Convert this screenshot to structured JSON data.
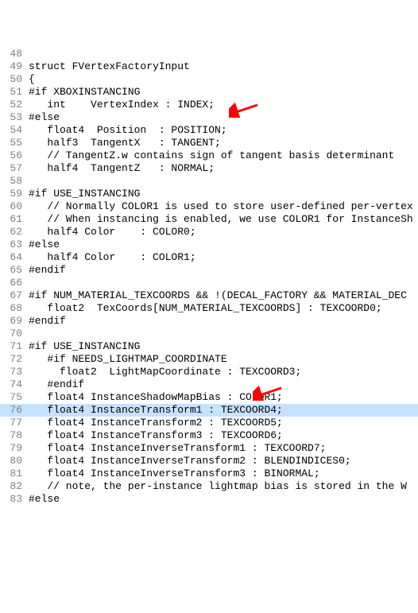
{
  "lines": [
    {
      "num": "48",
      "text": "",
      "hl": false
    },
    {
      "num": "49",
      "text": "struct FVertexFactoryInput",
      "hl": false
    },
    {
      "num": "50",
      "text": "{",
      "hl": false
    },
    {
      "num": "51",
      "text": "#if XBOXINSTANCING",
      "hl": false
    },
    {
      "num": "52",
      "text": "   int    VertexIndex : INDEX;",
      "hl": false
    },
    {
      "num": "53",
      "text": "#else",
      "hl": false
    },
    {
      "num": "54",
      "text": "   float4  Position  : POSITION;",
      "hl": false
    },
    {
      "num": "55",
      "text": "   half3  TangentX   : TANGENT;",
      "hl": false
    },
    {
      "num": "56",
      "text": "   // TangentZ.w contains sign of tangent basis determinant",
      "hl": false
    },
    {
      "num": "57",
      "text": "   half4  TangentZ   : NORMAL;",
      "hl": false
    },
    {
      "num": "58",
      "text": "",
      "hl": false
    },
    {
      "num": "59",
      "text": "#if USE_INSTANCING",
      "hl": false
    },
    {
      "num": "60",
      "text": "   // Normally COLOR1 is used to store user-defined per-vertex",
      "hl": false
    },
    {
      "num": "61",
      "text": "   // When instancing is enabled, we use COLOR1 for InstanceSh",
      "hl": false
    },
    {
      "num": "62",
      "text": "   half4 Color    : COLOR0;",
      "hl": false
    },
    {
      "num": "63",
      "text": "#else",
      "hl": false
    },
    {
      "num": "64",
      "text": "   half4 Color    : COLOR1;",
      "hl": false
    },
    {
      "num": "65",
      "text": "#endif",
      "hl": false
    },
    {
      "num": "66",
      "text": "",
      "hl": false
    },
    {
      "num": "67",
      "text": "#if NUM_MATERIAL_TEXCOORDS && !(DECAL_FACTORY && MATERIAL_DEC",
      "hl": false
    },
    {
      "num": "68",
      "text": "   float2  TexCoords[NUM_MATERIAL_TEXCOORDS] : TEXCOORD0;",
      "hl": false
    },
    {
      "num": "69",
      "text": "#endif",
      "hl": false
    },
    {
      "num": "70",
      "text": "",
      "hl": false
    },
    {
      "num": "71",
      "text": "#if USE_INSTANCING",
      "hl": false
    },
    {
      "num": "72",
      "text": "   #if NEEDS_LIGHTMAP_COORDINATE",
      "hl": false
    },
    {
      "num": "73",
      "text": "     float2  LightMapCoordinate : TEXCOORD3;",
      "hl": false
    },
    {
      "num": "74",
      "text": "   #endif",
      "hl": false
    },
    {
      "num": "75",
      "text": "   float4 InstanceShadowMapBias : COLOR1;",
      "hl": false
    },
    {
      "num": "76",
      "text": "   float4 InstanceTransform1 : TEXCOORD4;",
      "hl": true
    },
    {
      "num": "77",
      "text": "   float4 InstanceTransform2 : TEXCOORD5;",
      "hl": false
    },
    {
      "num": "78",
      "text": "   float4 InstanceTransform3 : TEXCOORD6;",
      "hl": false
    },
    {
      "num": "79",
      "text": "   float4 InstanceInverseTransform1 : TEXCOORD7;",
      "hl": false
    },
    {
      "num": "80",
      "text": "   float4 InstanceInverseTransform2 : BLENDINDICES0;",
      "hl": false
    },
    {
      "num": "81",
      "text": "   float4 InstanceInverseTransform3 : BINORMAL;",
      "hl": false
    },
    {
      "num": "82",
      "text": "   // note, the per-instance lightmap bias is stored in the W",
      "hl": false
    },
    {
      "num": "83",
      "text": "#else",
      "hl": false
    }
  ],
  "arrow_color": "#ff0000"
}
